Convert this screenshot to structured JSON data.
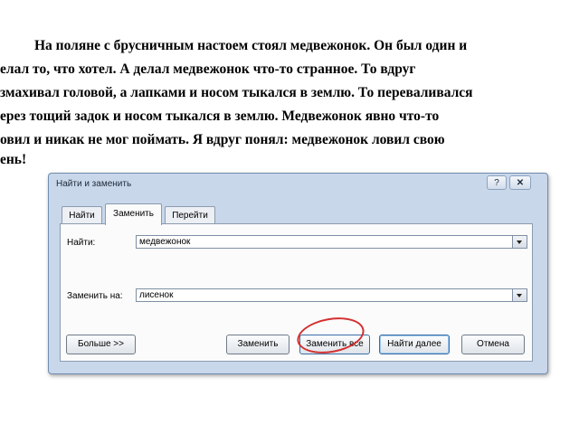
{
  "document": {
    "lines": [
      "На поляне с брусничным настоем стоял медвежонок. Он был один и",
      "елал то, что хотел. А делал медвежонок что-то странное. То вдруг",
      "змахивал головой, а лапками и носом тыкался в землю. То переваливался",
      "ерез тощий задок и носом тыкался в землю. Медвежонок явно что-то",
      "овил и никак не мог поймать. Я вдруг понял: медвежонок ловил свою",
      "ень!"
    ]
  },
  "dialog": {
    "title": "Найти и заменить",
    "help_label": "?",
    "close_label": "✕",
    "tabs": [
      {
        "label": "Найти"
      },
      {
        "label": "Заменить",
        "active": true
      },
      {
        "label": "Перейти"
      }
    ],
    "find_label": "Найти:",
    "find_value": "медвежонок",
    "replace_label": "Заменить на:",
    "replace_value": "лисенок",
    "buttons": {
      "more": "Больше >>",
      "replace": "Заменить",
      "replace_all": "Заменить все",
      "find_next": "Найти далее",
      "cancel": "Отмена"
    }
  },
  "colors": {
    "highlight": "#d42f2f",
    "dialog_frame": "#c9d7ea"
  },
  "icons": {
    "combo_arrow": "chevron-down-icon",
    "close": "close-icon",
    "help": "help-icon"
  }
}
